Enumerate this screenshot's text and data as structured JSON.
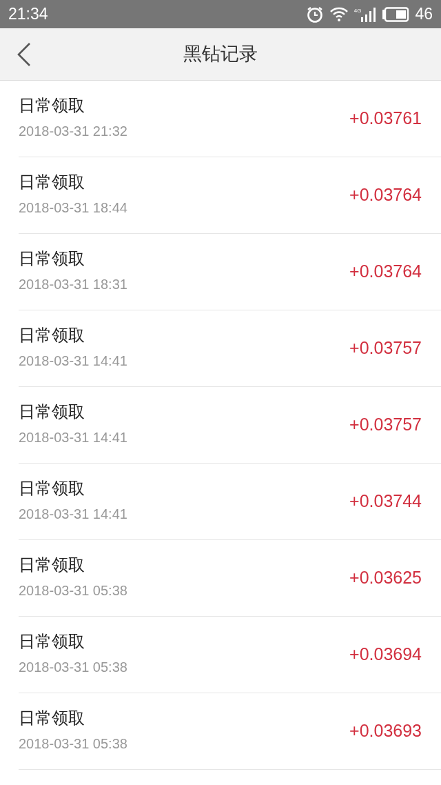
{
  "status_bar": {
    "time": "21:34",
    "network": "4G",
    "battery_text": "46"
  },
  "header": {
    "title": "黑钻记录"
  },
  "records": [
    {
      "title": "日常领取",
      "time": "2018-03-31 21:32",
      "amount": "+0.03761"
    },
    {
      "title": "日常领取",
      "time": "2018-03-31 18:44",
      "amount": "+0.03764"
    },
    {
      "title": "日常领取",
      "time": "2018-03-31 18:31",
      "amount": "+0.03764"
    },
    {
      "title": "日常领取",
      "time": "2018-03-31 14:41",
      "amount": "+0.03757"
    },
    {
      "title": "日常领取",
      "time": "2018-03-31 14:41",
      "amount": "+0.03757"
    },
    {
      "title": "日常领取",
      "time": "2018-03-31 14:41",
      "amount": "+0.03744"
    },
    {
      "title": "日常领取",
      "time": "2018-03-31 05:38",
      "amount": "+0.03625"
    },
    {
      "title": "日常领取",
      "time": "2018-03-31 05:38",
      "amount": "+0.03694"
    },
    {
      "title": "日常领取",
      "time": "2018-03-31 05:38",
      "amount": "+0.03693"
    }
  ]
}
